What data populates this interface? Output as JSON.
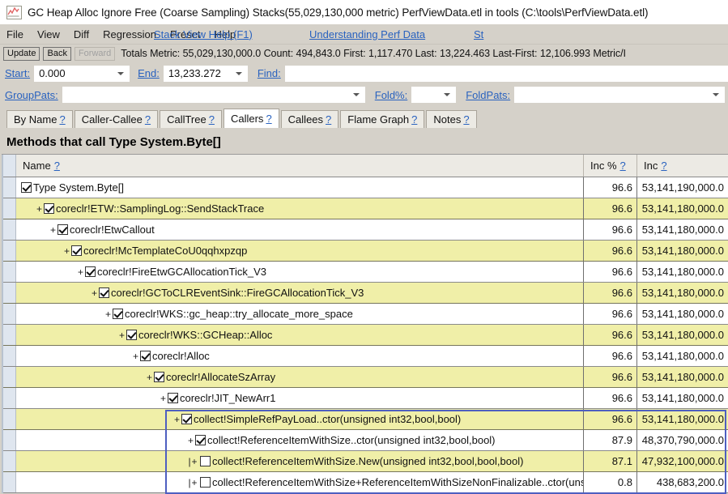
{
  "window": {
    "icon": "chart-line-icon",
    "title": "GC Heap Alloc Ignore Free (Coarse Sampling) Stacks(55,029,130,000 metric) PerfViewData.etl in tools (C:\\tools\\PerfViewData.etl)"
  },
  "menu": {
    "items": [
      {
        "label": "File"
      },
      {
        "label": "View"
      },
      {
        "label": "Diff"
      },
      {
        "label": "Regression"
      },
      {
        "label": "Preset"
      },
      {
        "label": "Help"
      }
    ],
    "links": [
      {
        "label": "Stack View Help (F1)"
      },
      {
        "label": "Understanding Perf Data"
      },
      {
        "label": "St"
      }
    ]
  },
  "toolbar": {
    "update_label": "Update",
    "back_label": "Back",
    "forward_label": "Forward",
    "totals_text": "Totals Metric: 55,029,130,000.0  Count: 494,843.0  First: 1,117.470 Last: 13,224.463  Last-First: 12,106.993  Metric/I"
  },
  "filters": {
    "start_label": "Start:",
    "start_value": "0.000",
    "end_label": "End:",
    "end_value": "13,233.272",
    "find_label": "Find:",
    "find_value": "",
    "grouppats_label": "GroupPats:",
    "grouppats_value": "",
    "foldpct_label": "Fold%:",
    "foldpct_value": "",
    "foldpats_label": "FoldPats:",
    "foldpats_value": ""
  },
  "tabs": [
    {
      "label": "By Name",
      "help": "?",
      "active": false
    },
    {
      "label": "Caller-Callee",
      "help": "?",
      "active": false
    },
    {
      "label": "CallTree",
      "help": "?",
      "active": false
    },
    {
      "label": "Callers",
      "help": "?",
      "active": true
    },
    {
      "label": "Callees",
      "help": "?",
      "active": false
    },
    {
      "label": "Flame Graph",
      "help": "?",
      "active": false
    },
    {
      "label": "Notes",
      "help": "?",
      "active": false
    }
  ],
  "heading": "Methods that call Type System.Byte[]",
  "grid": {
    "columns": [
      {
        "label": "Name",
        "help": "?"
      },
      {
        "label": "Inc %",
        "help": "?"
      },
      {
        "label": "Inc",
        "help": "?"
      }
    ],
    "rows": [
      {
        "indent": 0,
        "expander": "",
        "checked": true,
        "name": "Type System.Byte[]",
        "inc_pct": "96.6",
        "inc": "53,141,190,000.0",
        "band": "white",
        "selected": false
      },
      {
        "indent": 1,
        "expander": "+",
        "checked": true,
        "name": "coreclr!ETW::SamplingLog::SendStackTrace",
        "inc_pct": "96.6",
        "inc": "53,141,180,000.0",
        "band": "yellow",
        "selected": false
      },
      {
        "indent": 2,
        "expander": "+",
        "checked": true,
        "name": "coreclr!EtwCallout",
        "inc_pct": "96.6",
        "inc": "53,141,180,000.0",
        "band": "white",
        "selected": false
      },
      {
        "indent": 3,
        "expander": "+",
        "checked": true,
        "name": "coreclr!McTemplateCoU0qqhxpzqp",
        "inc_pct": "96.6",
        "inc": "53,141,180,000.0",
        "band": "yellow",
        "selected": false
      },
      {
        "indent": 4,
        "expander": "+",
        "checked": true,
        "name": "coreclr!FireEtwGCAllocationTick_V3",
        "inc_pct": "96.6",
        "inc": "53,141,180,000.0",
        "band": "white",
        "selected": false
      },
      {
        "indent": 5,
        "expander": "+",
        "checked": true,
        "name": "coreclr!GCToCLREventSink::FireGCAllocationTick_V3",
        "inc_pct": "96.6",
        "inc": "53,141,180,000.0",
        "band": "yellow",
        "selected": false
      },
      {
        "indent": 6,
        "expander": "+",
        "checked": true,
        "name": "coreclr!WKS::gc_heap::try_allocate_more_space",
        "inc_pct": "96.6",
        "inc": "53,141,180,000.0",
        "band": "white",
        "selected": false
      },
      {
        "indent": 7,
        "expander": "+",
        "checked": true,
        "name": "coreclr!WKS::GCHeap::Alloc",
        "inc_pct": "96.6",
        "inc": "53,141,180,000.0",
        "band": "yellow",
        "selected": false
      },
      {
        "indent": 8,
        "expander": "+",
        "checked": true,
        "name": "coreclr!Alloc",
        "inc_pct": "96.6",
        "inc": "53,141,180,000.0",
        "band": "white",
        "selected": false
      },
      {
        "indent": 9,
        "expander": "+",
        "checked": true,
        "name": "coreclr!AllocateSzArray",
        "inc_pct": "96.6",
        "inc": "53,141,180,000.0",
        "band": "yellow",
        "selected": false
      },
      {
        "indent": 10,
        "expander": "+",
        "checked": true,
        "name": "coreclr!JIT_NewArr1",
        "inc_pct": "96.6",
        "inc": "53,141,180,000.0",
        "band": "white",
        "selected": false
      },
      {
        "indent": 11,
        "expander": "+",
        "checked": true,
        "name": "collect!SimpleRefPayLoad..ctor(unsigned int32,bool,bool)",
        "inc_pct": "96.6",
        "inc": "53,141,180,000.0",
        "band": "yellow",
        "selected": true
      },
      {
        "indent": 12,
        "expander": "+",
        "checked": true,
        "name": "collect!ReferenceItemWithSize..ctor(unsigned int32,bool,bool)",
        "inc_pct": "87.9",
        "inc": "48,370,790,000.0",
        "band": "white",
        "selected": true
      },
      {
        "indent": 12,
        "expander": "|+",
        "checked": false,
        "name": "collect!ReferenceItemWithSize.New(unsigned int32,bool,bool,bool)",
        "inc_pct": "87.1",
        "inc": "47,932,100,000.0",
        "band": "yellow",
        "selected": true
      },
      {
        "indent": 12,
        "expander": "|+",
        "checked": false,
        "name": "collect!ReferenceItemWithSize+ReferenceItemWithSizeNonFinalizable..ctor(unsigned",
        "inc_pct": "0.8",
        "inc": "438,683,200.0",
        "band": "white",
        "selected": true
      }
    ]
  },
  "colors": {
    "link": "#2962bf",
    "row_highlight": "#f0efa8",
    "selection_border": "#4e5fc0",
    "chrome": "#d5d1c9"
  }
}
